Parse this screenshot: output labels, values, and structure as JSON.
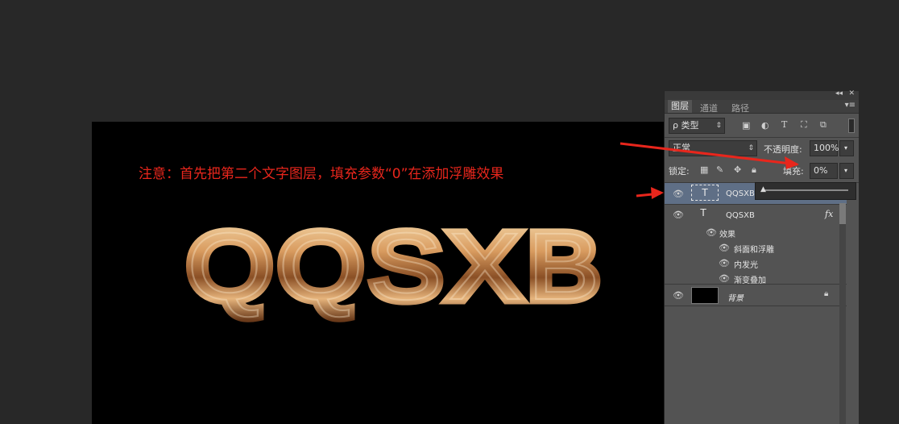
{
  "annotation": "注意：首先把第二个文字图层，填充参数“0”在添加浮雕效果",
  "artwork_text": "QQSXB",
  "colors": {
    "background": "#282828",
    "canvas": "#000000",
    "annotation": "#e8261c",
    "panel": "#535353",
    "gold_light": "#f6dcae",
    "gold_mid": "#c88a52",
    "gold_dark": "#6a3a1a"
  },
  "panel": {
    "collapse_icon": "double-chevron-left-icon",
    "close_icon": "close-icon",
    "tabs": [
      {
        "label": "图层",
        "active": true
      },
      {
        "label": "通道",
        "active": false
      },
      {
        "label": "路径",
        "active": false
      }
    ],
    "filter": {
      "label": "ρ 类型"
    },
    "blend_mode": "正常",
    "opacity": {
      "label": "不透明度:",
      "value": "100%"
    },
    "lock": {
      "label": "锁定:"
    },
    "fill": {
      "label": "填充:",
      "value": "0%"
    },
    "fill_slider_value": 0
  },
  "layers": [
    {
      "name": "QQSXB",
      "type": "text",
      "selected": true
    },
    {
      "name": "QQSXB",
      "type": "text",
      "fx": "fx",
      "effects_label": "效果",
      "effects": [
        "斜面和浮雕",
        "内发光",
        "渐变叠加"
      ]
    },
    {
      "name": "背景",
      "type": "background",
      "locked": true
    }
  ]
}
